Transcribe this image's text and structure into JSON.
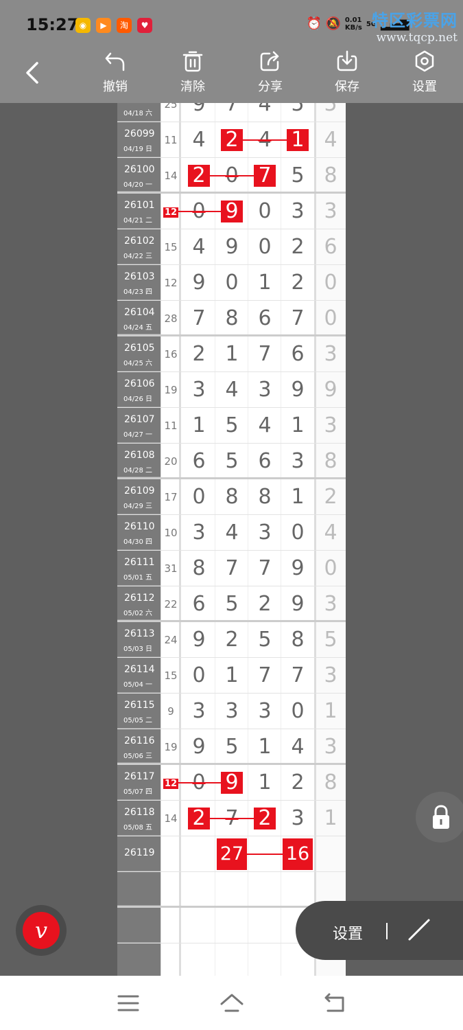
{
  "status": {
    "time": "15:27",
    "net_speed_line1": "0.01",
    "net_speed_line2": "KB/s",
    "network": "5G",
    "app_icon_taobao": "淘"
  },
  "watermark": {
    "title": "特区彩票网",
    "url": "www.tqcp.net"
  },
  "toolbar": {
    "undo": "撤销",
    "clear": "清除",
    "share": "分享",
    "save": "保存",
    "settings": "设置"
  },
  "table": {
    "top_partial": {
      "date": "04/18 六",
      "sum": "25",
      "digits": [
        "9",
        "7",
        "4",
        "5"
      ],
      "last": "5"
    },
    "rows": [
      {
        "issue": "26099",
        "date": "04/19 日",
        "sum": "11",
        "digits": [
          "4",
          "2",
          "4",
          "1"
        ],
        "last": "4"
      },
      {
        "issue": "26100",
        "date": "04/20 一",
        "sum": "14",
        "digits": [
          "2",
          "0",
          "7",
          "5"
        ],
        "last": "8"
      },
      {
        "issue": "26101",
        "date": "04/21 二",
        "sum": "12",
        "digits": [
          "0",
          "9",
          "0",
          "3"
        ],
        "last": "3"
      },
      {
        "issue": "26102",
        "date": "04/22 三",
        "sum": "15",
        "digits": [
          "4",
          "9",
          "0",
          "2"
        ],
        "last": "6"
      },
      {
        "issue": "26103",
        "date": "04/23 四",
        "sum": "12",
        "digits": [
          "9",
          "0",
          "1",
          "2"
        ],
        "last": "0"
      },
      {
        "issue": "26104",
        "date": "04/24 五",
        "sum": "28",
        "digits": [
          "7",
          "8",
          "6",
          "7"
        ],
        "last": "0"
      },
      {
        "issue": "26105",
        "date": "04/25 六",
        "sum": "16",
        "digits": [
          "2",
          "1",
          "7",
          "6"
        ],
        "last": "3"
      },
      {
        "issue": "26106",
        "date": "04/26 日",
        "sum": "19",
        "digits": [
          "3",
          "4",
          "3",
          "9"
        ],
        "last": "9"
      },
      {
        "issue": "26107",
        "date": "04/27 一",
        "sum": "11",
        "digits": [
          "1",
          "5",
          "4",
          "1"
        ],
        "last": "3"
      },
      {
        "issue": "26108",
        "date": "04/28 二",
        "sum": "20",
        "digits": [
          "6",
          "5",
          "6",
          "3"
        ],
        "last": "8"
      },
      {
        "issue": "26109",
        "date": "04/29 三",
        "sum": "17",
        "digits": [
          "0",
          "8",
          "8",
          "1"
        ],
        "last": "2"
      },
      {
        "issue": "26110",
        "date": "04/30 四",
        "sum": "10",
        "digits": [
          "3",
          "4",
          "3",
          "0"
        ],
        "last": "4"
      },
      {
        "issue": "26111",
        "date": "05/01 五",
        "sum": "31",
        "digits": [
          "8",
          "7",
          "7",
          "9"
        ],
        "last": "0"
      },
      {
        "issue": "26112",
        "date": "05/02 六",
        "sum": "22",
        "digits": [
          "6",
          "5",
          "2",
          "9"
        ],
        "last": "3"
      },
      {
        "issue": "26113",
        "date": "05/03 日",
        "sum": "24",
        "digits": [
          "9",
          "2",
          "5",
          "8"
        ],
        "last": "5"
      },
      {
        "issue": "26114",
        "date": "05/04 一",
        "sum": "15",
        "digits": [
          "0",
          "1",
          "7",
          "7"
        ],
        "last": "3"
      },
      {
        "issue": "26115",
        "date": "05/05 二",
        "sum": "9",
        "digits": [
          "3",
          "3",
          "3",
          "0"
        ],
        "last": "1"
      },
      {
        "issue": "26116",
        "date": "05/06 三",
        "sum": "19",
        "digits": [
          "9",
          "5",
          "1",
          "4"
        ],
        "last": "3"
      },
      {
        "issue": "26117",
        "date": "05/07 四",
        "sum": "12",
        "digits": [
          "0",
          "9",
          "1",
          "2"
        ],
        "last": "8"
      },
      {
        "issue": "26118",
        "date": "05/08 五",
        "sum": "14",
        "digits": [
          "2",
          "7",
          "2",
          "3"
        ],
        "last": "1"
      },
      {
        "issue": "26119",
        "date": "",
        "sum": "",
        "digits": [
          "",
          "",
          "",
          ""
        ],
        "last": ""
      }
    ],
    "prediction": [
      "27",
      "16"
    ]
  },
  "floating": {
    "settings_label": "设置",
    "pen_glyph": "v"
  },
  "colors": {
    "accent": "#e8121e",
    "toolbar": "#8a8a8a",
    "issue_column": "#7a7a7a",
    "background": "#5f5f5f"
  }
}
